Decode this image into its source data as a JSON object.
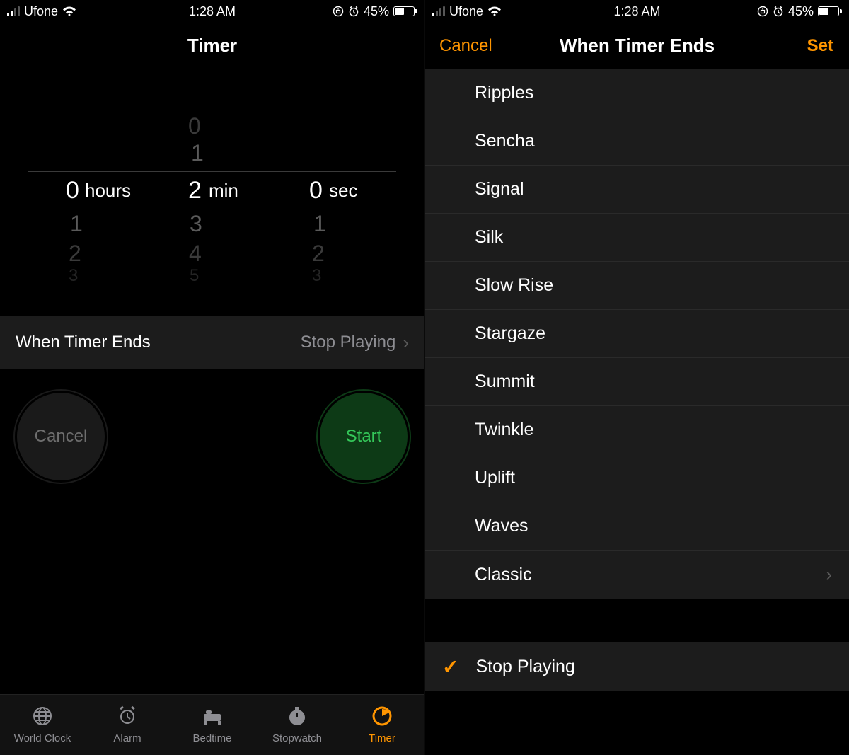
{
  "status": {
    "carrier": "Ufone",
    "time": "1:28 AM",
    "battery_pct": "45%"
  },
  "left": {
    "header_title": "Timer",
    "picker": {
      "hours_val": "0",
      "hours_label": "hours",
      "hours_below": [
        "1",
        "2",
        "3"
      ],
      "mins_above": [
        "0",
        "1"
      ],
      "mins_val": "2",
      "mins_label": "min",
      "mins_below": [
        "3",
        "4",
        "5"
      ],
      "secs_val": "0",
      "secs_label": "sec",
      "secs_below": [
        "1",
        "2",
        "3"
      ]
    },
    "when_ends_label": "When Timer Ends",
    "when_ends_value": "Stop Playing",
    "cancel_label": "Cancel",
    "start_label": "Start",
    "tabs": {
      "world_clock": "World Clock",
      "alarm": "Alarm",
      "bedtime": "Bedtime",
      "stopwatch": "Stopwatch",
      "timer": "Timer"
    }
  },
  "right": {
    "cancel": "Cancel",
    "title": "When Timer Ends",
    "set": "Set",
    "ringtones": [
      "Ripples",
      "Sencha",
      "Signal",
      "Silk",
      "Slow Rise",
      "Stargaze",
      "Summit",
      "Twinkle",
      "Uplift",
      "Waves",
      "Classic"
    ],
    "classic_has_chevron": true,
    "stop_playing_label": "Stop Playing"
  }
}
